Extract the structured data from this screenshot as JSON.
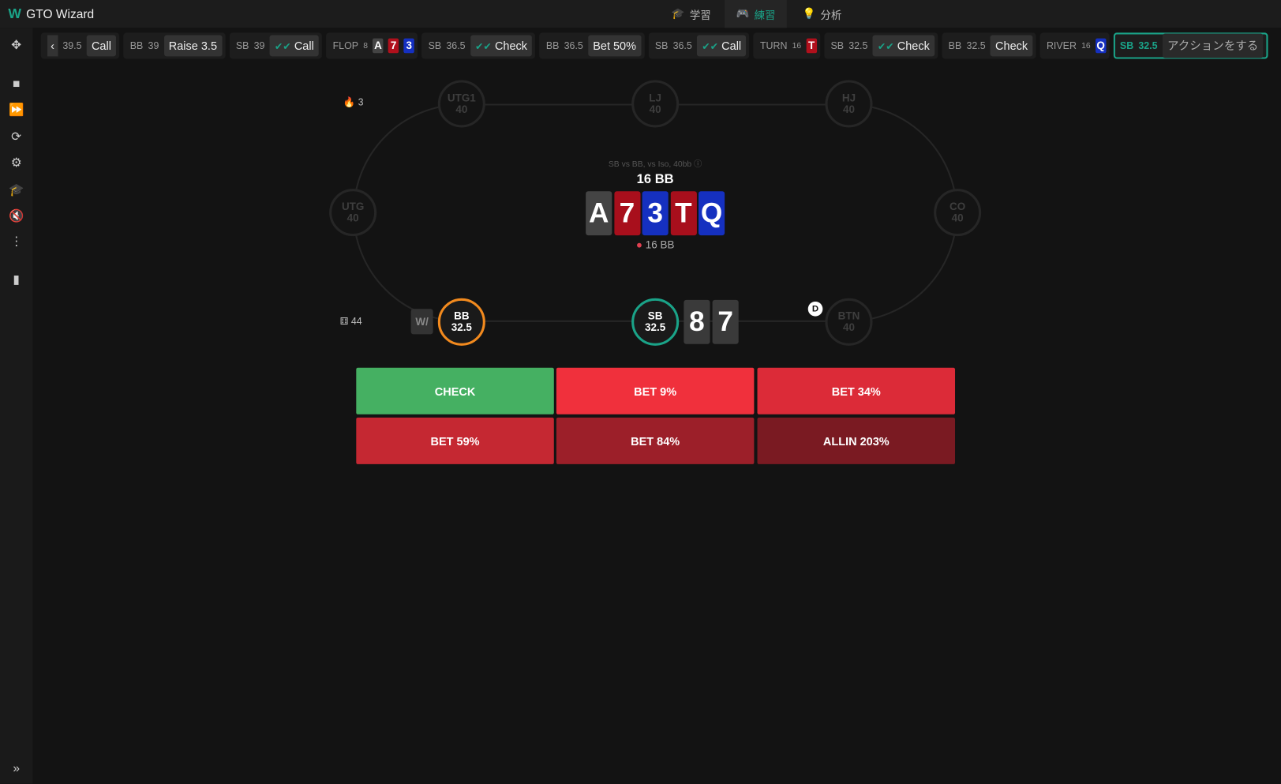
{
  "app": {
    "logo": "W",
    "title": "GTO Wizard"
  },
  "nav": [
    {
      "label": "学習",
      "icon": "graduation-cap-icon"
    },
    {
      "label": "練習",
      "icon": "gamepad-icon",
      "active": true
    },
    {
      "label": "分析",
      "icon": "lightbulb-icon"
    }
  ],
  "actions": [
    {
      "pos": "",
      "stack": "39.5",
      "action": "Call"
    },
    {
      "pos": "BB",
      "stack": "39",
      "action": "Raise 3.5"
    },
    {
      "pos": "SB",
      "stack": "39",
      "action": "Call",
      "check": true
    },
    {
      "street": "FLOP",
      "pot": "8",
      "cards": [
        {
          "r": "A",
          "c": "#444"
        },
        {
          "r": "7",
          "c": "#b0101c"
        },
        {
          "r": "3",
          "c": "#1530c0"
        }
      ]
    },
    {
      "pos": "SB",
      "stack": "36.5",
      "action": "Check",
      "check": true
    },
    {
      "pos": "BB",
      "stack": "36.5",
      "action": "Bet 50%"
    },
    {
      "pos": "SB",
      "stack": "36.5",
      "action": "Call",
      "check": true
    },
    {
      "street": "TURN",
      "pot": "16",
      "cards": [
        {
          "r": "T",
          "c": "#b0101c"
        }
      ]
    },
    {
      "pos": "SB",
      "stack": "32.5",
      "action": "Check",
      "check": true
    },
    {
      "pos": "BB",
      "stack": "32.5",
      "action": "Check"
    },
    {
      "street": "RIVER",
      "pot": "16",
      "cards": [
        {
          "r": "Q",
          "c": "#1530c0"
        }
      ]
    },
    {
      "pos": "SB",
      "stack": "32.5",
      "action": "アクションをする",
      "current": true
    }
  ],
  "table": {
    "streak": "3",
    "hands": "44",
    "info": "SB vs BB, vs Iso, 40bb",
    "pot_label": "16 BB",
    "bet_label": "16 BB",
    "board": [
      {
        "r": "A",
        "c": "#444444"
      },
      {
        "r": "7",
        "c": "#a80f1c"
      },
      {
        "r": "3",
        "c": "#1530c0"
      },
      {
        "r": "T",
        "c": "#a80f1c"
      },
      {
        "r": "Q",
        "c": "#1530c0"
      }
    ],
    "hero_cards": [
      "8",
      "7"
    ],
    "dealer": "D",
    "seats": {
      "UTG1": "40",
      "LJ": "40",
      "HJ": "40",
      "UTG": "40",
      "CO": "40",
      "BB": "32.5",
      "SB": "32.5",
      "BTN": "40"
    }
  },
  "buttons": [
    {
      "label": "CHECK",
      "color": "#45b062"
    },
    {
      "label": "BET 9%",
      "color": "#f0303c"
    },
    {
      "label": "BET 34%",
      "color": "#dc2b38"
    },
    {
      "label": "BET 59%",
      "color": "#c52832"
    },
    {
      "label": "BET 84%",
      "color": "#9c1f29"
    },
    {
      "label": "ALLIN 203%",
      "color": "#7a1a22"
    }
  ]
}
